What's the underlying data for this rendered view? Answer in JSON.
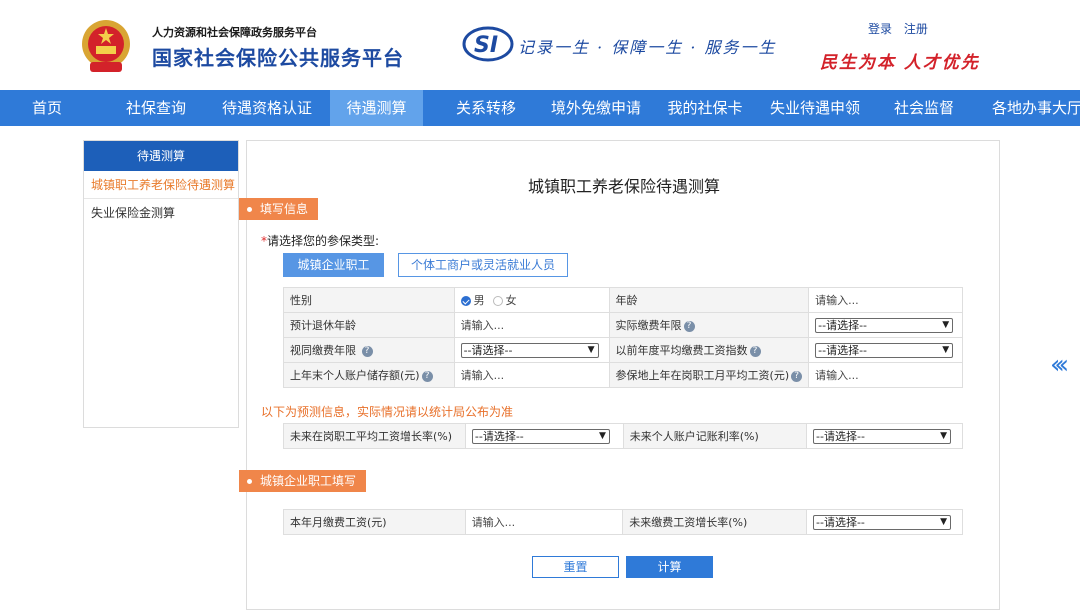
{
  "header": {
    "org_sub": "人力资源和社会保障政务服务平台",
    "org_main": "国家社会保险公共服务平台",
    "slogan_left": "记录一生 · 保障一生 · 服务一生",
    "slogan_right": "民生为本 人才优先",
    "login": "登录",
    "register": "注册"
  },
  "nav": {
    "items": [
      "首页",
      "社保查询",
      "待遇资格认证",
      "待遇测算",
      "关系转移",
      "境外免缴申请",
      "我的社保卡",
      "失业待遇申领",
      "社会监督",
      "各地办事大厅"
    ],
    "active": "待遇测算"
  },
  "sidebar": {
    "title": "待遇测算",
    "items": [
      "城镇职工养老保险待遇测算",
      "失业保险金测算"
    ]
  },
  "main": {
    "title": "城镇职工养老保险待遇测算",
    "section_fill": "填写信息",
    "insurance_type_label": "请选择您的参保类型:",
    "type_buttons": [
      "城镇企业职工",
      "个体工商户或灵活就业人员"
    ],
    "form": {
      "gender_label": "性别",
      "gender_male": "男",
      "gender_female": "女",
      "age_label": "年龄",
      "retire_age_label": "预计退休年龄",
      "actual_years_label": "实际缴费年限",
      "deemed_years_label": "视同缴费年限",
      "avg_index_label": "以前年度平均缴费工资指数",
      "balance_label": "上年末个人账户储存额(元)",
      "avg_wage_label": "参保地上年在岗职工月平均工资(元)"
    },
    "forecast_note": "以下为预测信息，实际情况请以统计局公布为准",
    "forecast": {
      "wage_growth_label": "未来在岗职工平均工资增长率(%)",
      "interest_label": "未来个人账户记账利率(%)"
    },
    "section_enterprise": "城镇企业职工填写",
    "enterprise": {
      "monthly_wage_label": "本年月缴费工资(元)",
      "wage_growth_label": "未来缴费工资增长率(%)"
    },
    "placeholder_input": "请输入...",
    "placeholder_select": "--请选择--",
    "reset_button": "重置",
    "calc_button": "计算"
  }
}
